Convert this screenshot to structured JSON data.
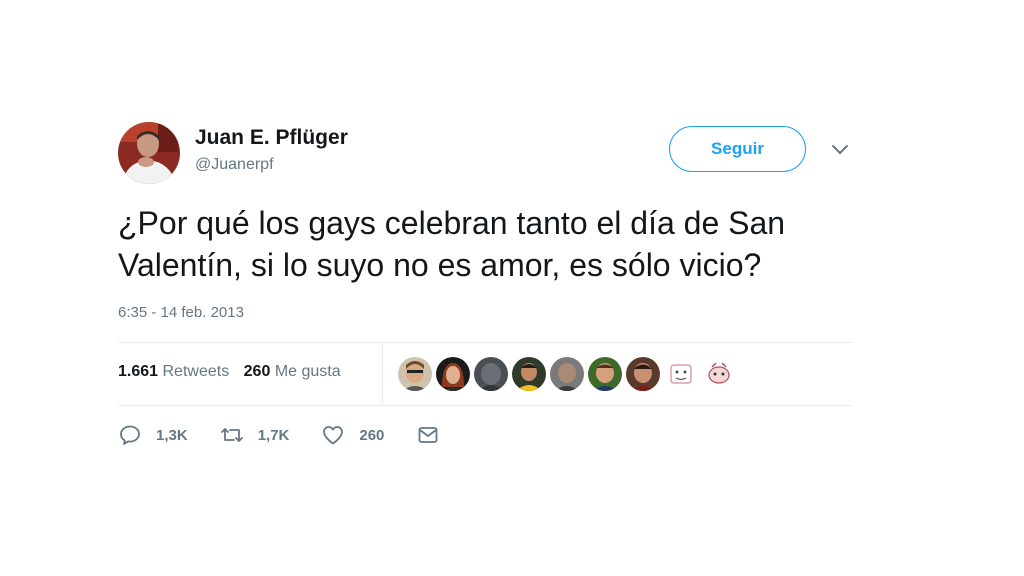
{
  "user": {
    "name": "Juan E. Pflüger",
    "handle": "@Juanerpf",
    "avatar_icon": "profile-photo"
  },
  "follow_label": "Seguir",
  "menu_icon": "chevron-down-icon",
  "tweet": {
    "text": "¿Por qué los gays celebran tanto el día de San Valentín, si lo suyo no es amor, es sólo vicio?",
    "timestamp": "6:35 - 14 feb. 2013"
  },
  "stats": {
    "retweets_count": "1.661",
    "retweets_label": "Retweets",
    "likes_count": "260",
    "likes_label": "Me gusta"
  },
  "liker_avatars": [
    {
      "icon": "avatar-1"
    },
    {
      "icon": "avatar-2"
    },
    {
      "icon": "avatar-3"
    },
    {
      "icon": "avatar-4"
    },
    {
      "icon": "avatar-5"
    },
    {
      "icon": "avatar-6"
    },
    {
      "icon": "avatar-7"
    },
    {
      "icon": "avatar-8"
    },
    {
      "icon": "avatar-9"
    }
  ],
  "actions": {
    "reply_count": "1,3K",
    "retweet_count": "1,7K",
    "like_count": "260"
  },
  "colors": {
    "accent": "#1da1f2",
    "text": "#14171a",
    "muted": "#657786",
    "border": "#e6ecf0"
  }
}
